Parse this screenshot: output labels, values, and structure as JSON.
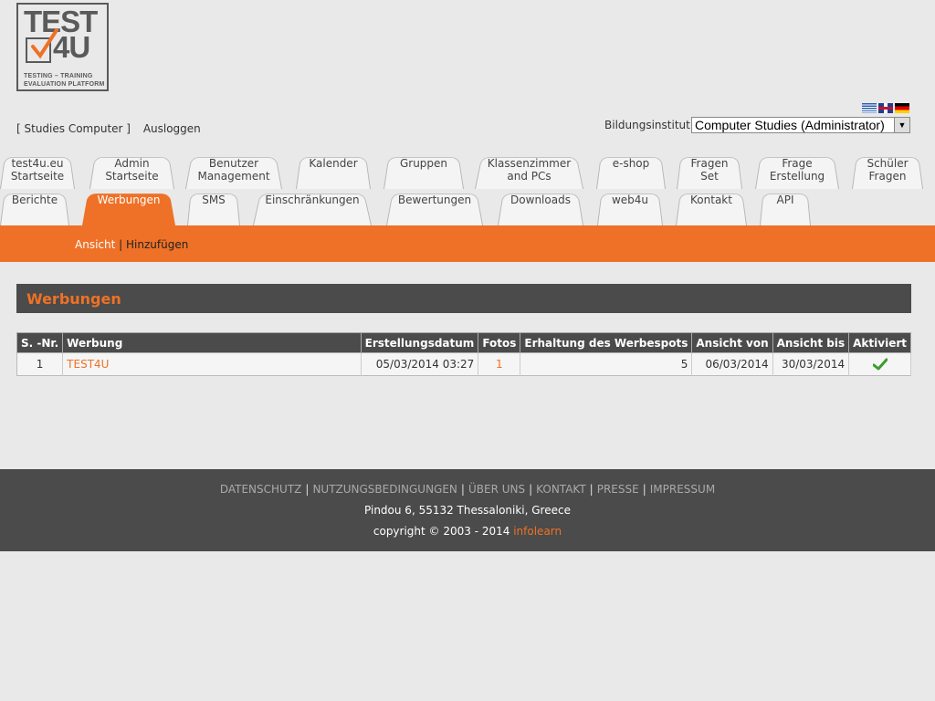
{
  "logo": {
    "line1": "TEST",
    "line2": "4U",
    "tagline1": "TESTING  –  TRAINING",
    "tagline2": "EVALUATION PLATFORM"
  },
  "user": {
    "name": "[ Studies Computer ]",
    "logout": "Ausloggen"
  },
  "institute": {
    "label": "Bildungsinstitut:",
    "selected": "Computer Studies (Administrator)"
  },
  "flags": [
    "greek-flag",
    "uk-flag",
    "german-flag"
  ],
  "tabs_row1": [
    {
      "line1": "test4u.eu",
      "line2": "Startseite"
    },
    {
      "line1": "Admin",
      "line2": "Startseite"
    },
    {
      "line1": "Benutzer",
      "line2": "Management"
    },
    {
      "line1": "Kalender",
      "line2": ""
    },
    {
      "line1": "Gruppen",
      "line2": ""
    },
    {
      "line1": "Klassenzimmer",
      "line2": "and PCs"
    },
    {
      "line1": "e-shop",
      "line2": ""
    },
    {
      "line1": "Fragen",
      "line2": "Set"
    },
    {
      "line1": "Frage",
      "line2": "Erstellung"
    },
    {
      "line1": "Schüler",
      "line2": "Fragen"
    }
  ],
  "tabs_row2": [
    {
      "label": "Berichte"
    },
    {
      "label": "Werbungen"
    },
    {
      "label": "SMS"
    },
    {
      "label": "Einschränkungen"
    },
    {
      "label": "Bewertungen"
    },
    {
      "label": "Downloads"
    },
    {
      "label": "web4u"
    },
    {
      "label": "Kontakt"
    },
    {
      "label": "API"
    }
  ],
  "subnav": {
    "view": "Ansicht",
    "sep": "|",
    "add": "Hinzufügen"
  },
  "section_title": "Werbungen",
  "table": {
    "headers": [
      "S. -Nr.",
      "Werbung",
      "Erstellungsdatum",
      "Fotos",
      "Erhaltung des Werbespots",
      "Ansicht von",
      "Ansicht bis",
      "Aktiviert"
    ],
    "rows": [
      {
        "nr": "1",
        "name": "TEST4U",
        "created": "05/03/2014 03:27",
        "photos": "1",
        "retention": "5",
        "from": "06/03/2014",
        "to": "30/03/2014",
        "active": "check-icon"
      }
    ]
  },
  "footer": {
    "links": [
      "DATENSCHUTZ",
      "NUTZUNGSBEDINGUNGEN",
      "ÜBER UNS",
      "KONTAKT",
      "PRESSE",
      "IMPRESSUM"
    ],
    "address": "Pindou 6, 55132 Thessaloniki, Greece",
    "copyright": "copyright © 2003 - 2014 ",
    "brand": "infolearn"
  },
  "colors": {
    "accent": "#ee7127",
    "dark": "#4a4b4a",
    "background": "#e9e9e9"
  }
}
